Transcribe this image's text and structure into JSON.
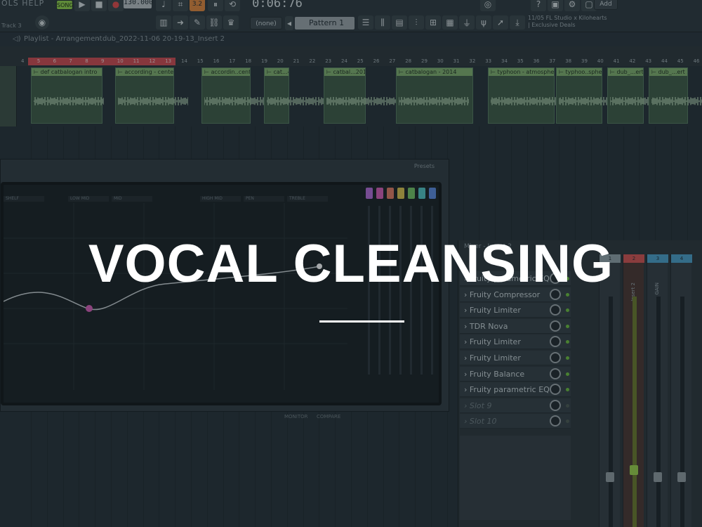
{
  "toolbar": {
    "menu": "OLS HELP",
    "song_badge": "SONG",
    "tempo": "130.000",
    "time": "0:06:76",
    "snap_value": "3.2",
    "pattern_select": "(none)",
    "pattern": "Pattern 1",
    "add_label": "Add",
    "news_line1": "11/05  FL Studio x Kilohearts",
    "news_line2": "| Exclusive Deals",
    "track_label": "Track 3"
  },
  "playlist": {
    "breadcrumb_title": "Playlist - Arrangement",
    "breadcrumb_file": "dub_2022-11-06 20-19-13_Insert 2",
    "ruler_ticks": [
      "4",
      "5",
      "6",
      "7",
      "8",
      "9",
      "10",
      "11",
      "12",
      "13",
      "14",
      "15",
      "16",
      "17",
      "18",
      "19",
      "20",
      "21",
      "22",
      "23",
      "24",
      "25",
      "26",
      "27",
      "28",
      "29",
      "30",
      "31",
      "32",
      "33",
      "34",
      "35",
      "36",
      "37",
      "38",
      "39",
      "40",
      "41",
      "42",
      "43",
      "44",
      "45",
      "46"
    ],
    "clips": [
      {
        "title": "def catbalogan intro"
      },
      {
        "title": "according - center"
      },
      {
        "title": "accordin..center"
      },
      {
        "title": "cat...4"
      },
      {
        "title": "catbal...2014"
      },
      {
        "title": "catbalogan - 2014"
      },
      {
        "title": "typhoon - atmosphere"
      },
      {
        "title": "typhoo..sphere"
      },
      {
        "title": "dub_...ert 2"
      },
      {
        "title": "dub_...ert 2"
      }
    ]
  },
  "eq": {
    "title": "Presets",
    "bands": [
      "SHELF",
      "LOW MID",
      "MID",
      "HIGH MID",
      "PEN",
      "TREBLE"
    ],
    "band_colors": [
      "#b46bd8",
      "#d65cb6",
      "#e07a62",
      "#d8c24c",
      "#72c463",
      "#4fc3c3",
      "#5a8ae0"
    ],
    "monitor_label": "MONITOR",
    "compare_label": "COMPARE"
  },
  "mixer": {
    "title": "Mixer - Insert 2",
    "slots": [
      {
        "name": "Fruity parametric EQ 2",
        "active": true
      },
      {
        "name": "Fruity Compressor",
        "active": true
      },
      {
        "name": "Fruity Limiter",
        "active": true
      },
      {
        "name": "TDR Nova",
        "active": true
      },
      {
        "name": "Fruity Limiter",
        "active": true
      },
      {
        "name": "Fruity Limiter",
        "active": true
      },
      {
        "name": "Fruity Balance",
        "active": true
      },
      {
        "name": "Fruity parametric EQ 2",
        "active": true
      },
      {
        "name": "Slot 9",
        "active": false
      },
      {
        "name": "Slot 10",
        "active": false
      }
    ],
    "strips": [
      {
        "num": "1",
        "name": "",
        "color": "#8fa0a6"
      },
      {
        "num": "2",
        "name": "Insert 2",
        "color": "#d4524f"
      },
      {
        "num": "3",
        "name": "GAIN",
        "color": "#4a9fc9"
      },
      {
        "num": "4",
        "name": "",
        "color": "#4a9fc9"
      }
    ]
  },
  "overlay": {
    "headline": "VOCAL CLEANSING"
  }
}
